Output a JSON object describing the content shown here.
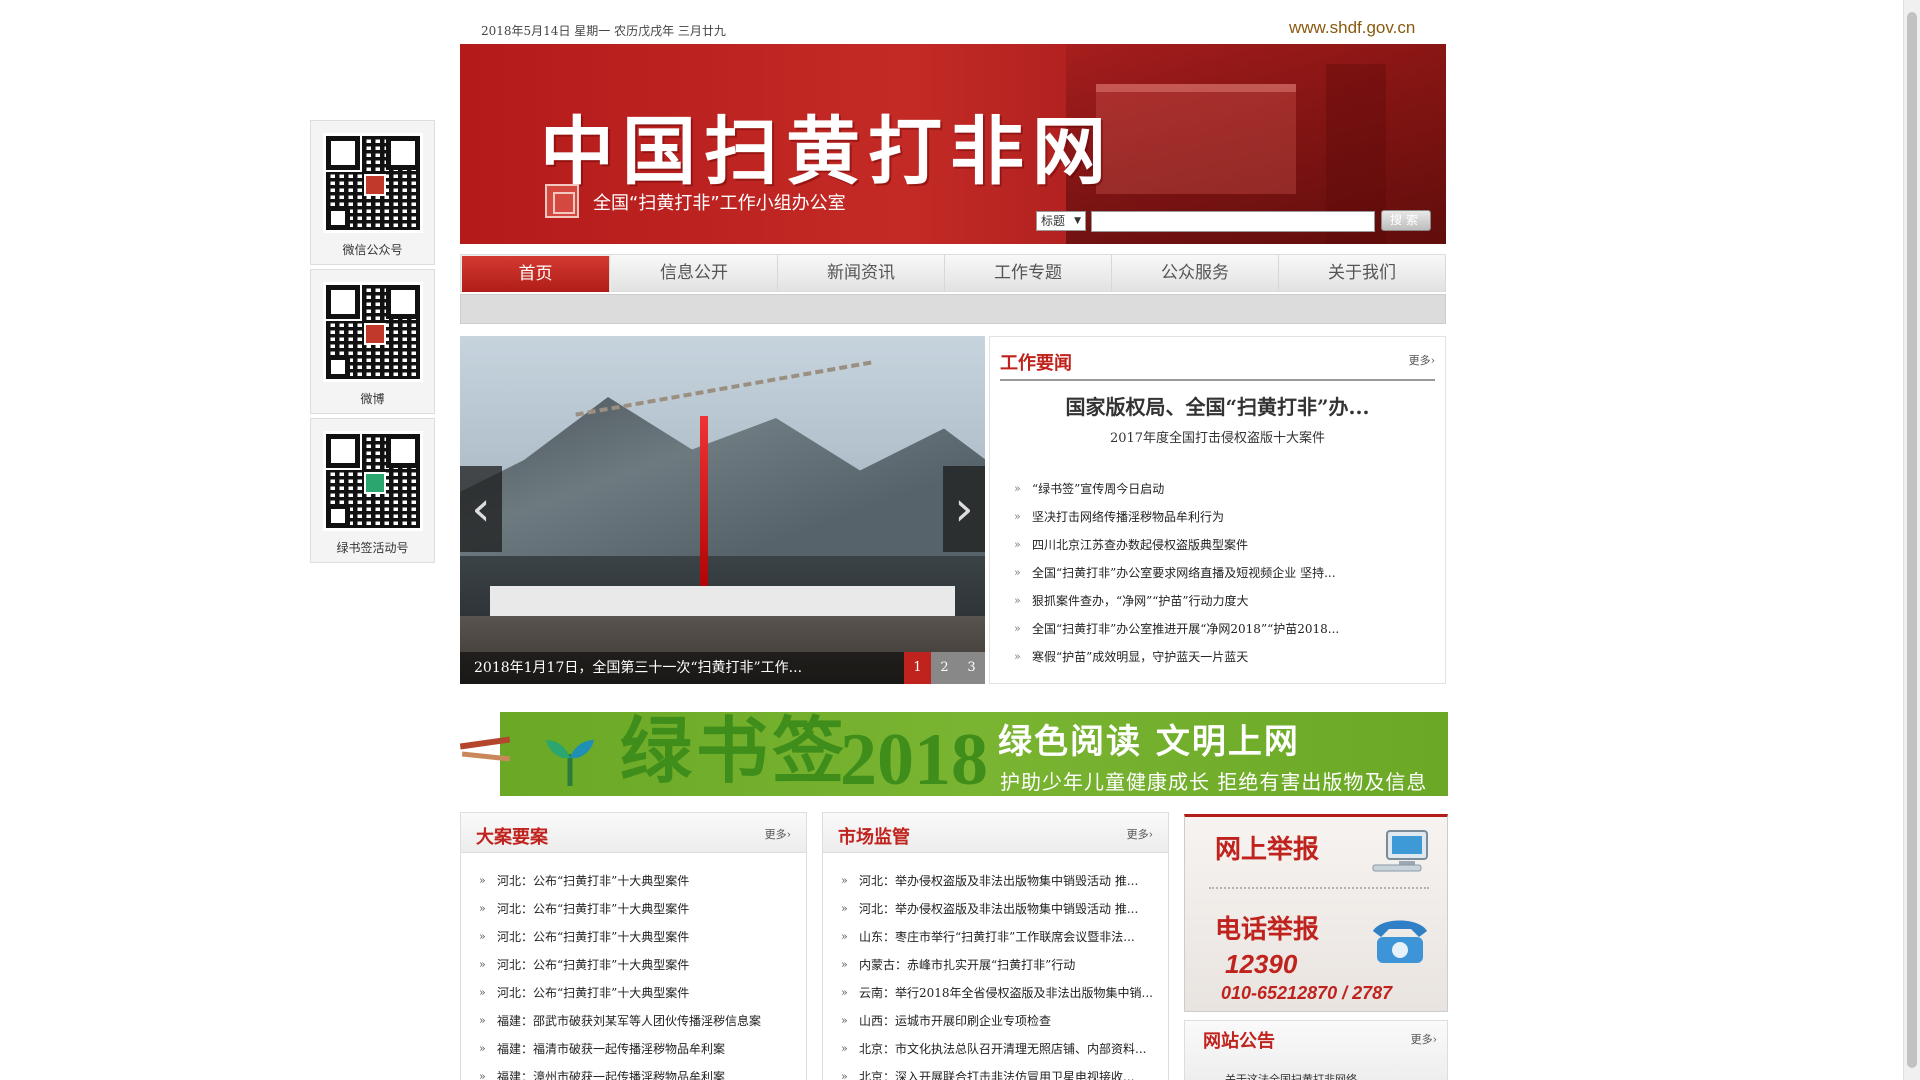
{
  "top": {
    "date": "2018年5月14日 星期一 农历戊戌年 三月廿九",
    "url": "www.shdf.gov.cn"
  },
  "banner": {
    "title": "中国扫黄打非网",
    "subtitle": "全国“扫黄打非”工作小组办公室",
    "search_select": "标题",
    "search_placeholder": "",
    "search_button": "搜索"
  },
  "nav": {
    "items": [
      "首页",
      "信息公开",
      "新闻资讯",
      "工作专题",
      "公众服务",
      "关于我们"
    ]
  },
  "qr_codes": [
    {
      "label": "微信公众号"
    },
    {
      "label": "微博"
    },
    {
      "label": "绿书签活动号"
    }
  ],
  "slider": {
    "caption": "2018年1月17日，全国第三十一次“扫黄打非”工作...",
    "pages": [
      "1",
      "2",
      "3"
    ],
    "active_page": "1",
    "prev": "‹",
    "next": "›"
  },
  "work_news": {
    "title": "工作要闻",
    "more": "更多›",
    "headline": "国家版权局、全国“扫黄打非”办...",
    "headline_sub": "2017年度全国打击侵权盗版十大案件",
    "items": [
      "“绿书签”宣传周今日启动",
      "坚决打击网络传播淫秽物品牟利行为",
      "四川北京江苏查办数起侵权盗版典型案件",
      "全国“扫黄打非”办公室要求网络直播及短视频企业 坚持...",
      "狠抓案件查办，“净网”“护苗”行动力度大",
      "全国“扫黄打非”办公室推进开展“净网2018”“护苗2018...",
      "寒假“护苗”成效明显，守护蓝天一片蓝天"
    ]
  },
  "green_banner": {
    "big_text": "绿书签",
    "year": "2018",
    "slogan": "绿色阅读  文明上网",
    "slogan2": "护助少年儿童健康成长  拒绝有害出版物及信息"
  },
  "major_cases": {
    "title": "大案要案",
    "more": "更多›",
    "items": [
      "河北：公布“扫黄打非”十大典型案件",
      "河北：公布“扫黄打非”十大典型案件",
      "河北：公布“扫黄打非”十大典型案件",
      "河北：公布“扫黄打非”十大典型案件",
      "河北：公布“扫黄打非”十大典型案件",
      "福建：邵武市破获刘某军等人团伙传播淫秽信息案",
      "福建：福清市破获一起传播淫秽物品牟利案",
      "福建：漳州市破获一起传播淫秽物品牟利案"
    ]
  },
  "market": {
    "title": "市场监管",
    "more": "更多›",
    "items": [
      "河北：举办侵权盗版及非法出版物集中销毁活动 推...",
      "河北：举办侵权盗版及非法出版物集中销毁活动 推...",
      "山东：枣庄市举行“扫黄打非”工作联席会议暨非法...",
      "内蒙古：赤峰市扎实开展“扫黄打非”行动",
      "云南：举行2018年全省侵权盗版及非法出版物集中销...",
      "山西：运城市开展印刷企业专项检查",
      "北京：市文化执法总队召开清理无照店铺、内部资料...",
      "北京：深入开展联合打击非法仿冒用卫星电视接收..."
    ]
  },
  "report": {
    "online": "网上举报",
    "phone": "电话举报",
    "hotline": "12390",
    "tel": "010-65212870 / 2787"
  },
  "notice": {
    "title": "网站公告",
    "more": "更多›",
    "item": "关于这法全国扫黄打非网络..."
  }
}
